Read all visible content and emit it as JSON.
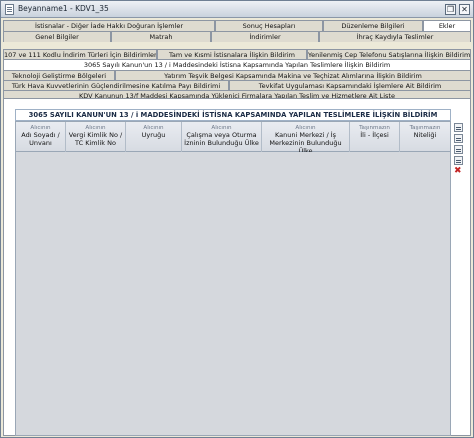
{
  "window": {
    "title": "Beyanname1 - KDV1_35"
  },
  "tabs_row1": [
    "İstisnalar - Diğer İade Hakkı Doğuran İşlemler",
    "Sonuç Hesapları",
    "Düzenleme Bilgileri",
    "Ekler"
  ],
  "tabs_row2": [
    "Genel Bilgiler",
    "Matrah",
    "İndirimler",
    "İhraç Kaydıyla Teslimler"
  ],
  "tabs_row3": [
    "107 ve 111 Kodlu İndirim Türleri İçin Bildirimler",
    "Tam ve Kısmi İstisnalara İlişkin Bildirim",
    "Yenilenmiş Cep Telefonu Satışlarına İlişkin Bildirim"
  ],
  "tabs_row4": [
    "3065 Sayılı Kanun'un 13 / i Maddesindeki İstisna Kapsamında Yapılan Teslimlere İlişkin Bildirim"
  ],
  "tabs_row5": [
    "Teknoloji Geliştirme Bölgeleri",
    "Yatırım Teşvik Belgesi Kapsamında Makina ve Teçhizat Alımlarına İlişkin Bildirim"
  ],
  "tabs_row6": [
    "Türk Hava Kuvvetlerinin Güçlendirilmesine Katılma Payı Bildirimi",
    "Tevkifat Uygulaması Kapsamındaki İşlemlere Ait Bildirim"
  ],
  "tabs_row7": [
    "KDV Kanunun 13/f Maddesi Kapsamında Yüklenici Firmalara Yapılan Teslim ve Hizmetlere Ait Liste"
  ],
  "table": {
    "title": "3065 SAYILI KANUN'UN 13 / i MADDESİNDEKİ İSTİSNA KAPSAMINDA YAPILAN TESLİMLERE İLİŞKİN BİLDİRİM",
    "columns": [
      {
        "small": "Alıcının",
        "main": "Adı Soyadı / Unvanı"
      },
      {
        "small": "Alıcının",
        "main": "Vergi Kimlik No / TC Kimlik No"
      },
      {
        "small": "Alıcının",
        "main": "Uyruğu"
      },
      {
        "small": "Alıcının",
        "main": "Çalışma veya Oturma İzninin Bulunduğu Ülke"
      },
      {
        "small": "Alıcının",
        "main": "Kanuni Merkezi / İş Merkezinin Bulunduğu Ülke"
      },
      {
        "small": "Taşınmazın",
        "main": "İli - İlçesi"
      },
      {
        "small": "Taşınmazın",
        "main": "Niteliği"
      }
    ]
  },
  "side_toolbar": [
    "add-row-icon",
    "insert-row-icon",
    "copy-row-icon",
    "edit-row-icon",
    "delete-row-icon"
  ],
  "colors": {
    "titlebar": "#c9d2dd",
    "active_tab": "#ffffff",
    "inactive_tab": "#dedbd0",
    "grid_bg": "#d5d8dd",
    "delete_red": "#c42424"
  }
}
